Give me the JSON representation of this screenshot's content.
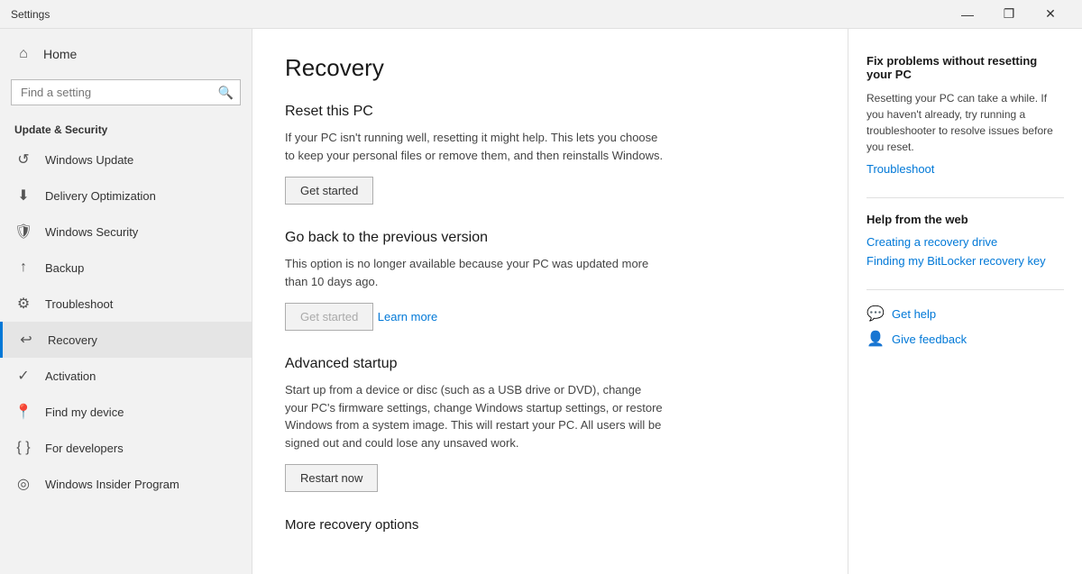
{
  "titlebar": {
    "title": "Settings",
    "minimize_label": "—",
    "maximize_label": "❐",
    "close_label": "✕"
  },
  "sidebar": {
    "home_label": "Home",
    "search_placeholder": "Find a setting",
    "section_title": "Update & Security",
    "items": [
      {
        "id": "windows-update",
        "label": "Windows Update",
        "icon": "↺"
      },
      {
        "id": "delivery-optimization",
        "label": "Delivery Optimization",
        "icon": "⬇"
      },
      {
        "id": "windows-security",
        "label": "Windows Security",
        "icon": "🛡"
      },
      {
        "id": "backup",
        "label": "Backup",
        "icon": "↑"
      },
      {
        "id": "troubleshoot",
        "label": "Troubleshoot",
        "icon": "⚙"
      },
      {
        "id": "recovery",
        "label": "Recovery",
        "icon": "↩",
        "active": true
      },
      {
        "id": "activation",
        "label": "Activation",
        "icon": "✓"
      },
      {
        "id": "find-my-device",
        "label": "Find my device",
        "icon": "📍"
      },
      {
        "id": "for-developers",
        "label": "For developers",
        "icon": "{ }"
      },
      {
        "id": "windows-insider-program",
        "label": "Windows Insider Program",
        "icon": "◎"
      }
    ]
  },
  "main": {
    "page_title": "Recovery",
    "sections": [
      {
        "id": "reset-pc",
        "title": "Reset this PC",
        "description": "If your PC isn't running well, resetting it might help. This lets you choose to keep your personal files or remove them, and then reinstalls Windows.",
        "button_label": "Get started",
        "button_disabled": false
      },
      {
        "id": "go-back",
        "title": "Go back to the previous version",
        "description": "This option is no longer available because your PC was updated more than 10 days ago.",
        "button_label": "Get started",
        "button_disabled": true,
        "learn_more_label": "Learn more"
      },
      {
        "id": "advanced-startup",
        "title": "Advanced startup",
        "description": "Start up from a device or disc (such as a USB drive or DVD), change your PC's firmware settings, change Windows startup settings, or restore Windows from a system image. This will restart your PC. All users will be signed out and could lose any unsaved work.",
        "button_label": "Restart now",
        "button_disabled": false
      }
    ],
    "more_recovery_options": "More recovery options"
  },
  "right_panel": {
    "fix_section": {
      "title": "Fix problems without resetting your PC",
      "description": "Resetting your PC can take a while. If you haven't already, try running a troubleshooter to resolve issues before you reset.",
      "link_label": "Troubleshoot"
    },
    "help_section": {
      "title": "Help from the web",
      "links": [
        "Creating a recovery drive",
        "Finding my BitLocker recovery key"
      ]
    },
    "actions": [
      {
        "id": "get-help",
        "icon": "💬",
        "label": "Get help"
      },
      {
        "id": "give-feedback",
        "icon": "👤",
        "label": "Give feedback"
      }
    ]
  }
}
